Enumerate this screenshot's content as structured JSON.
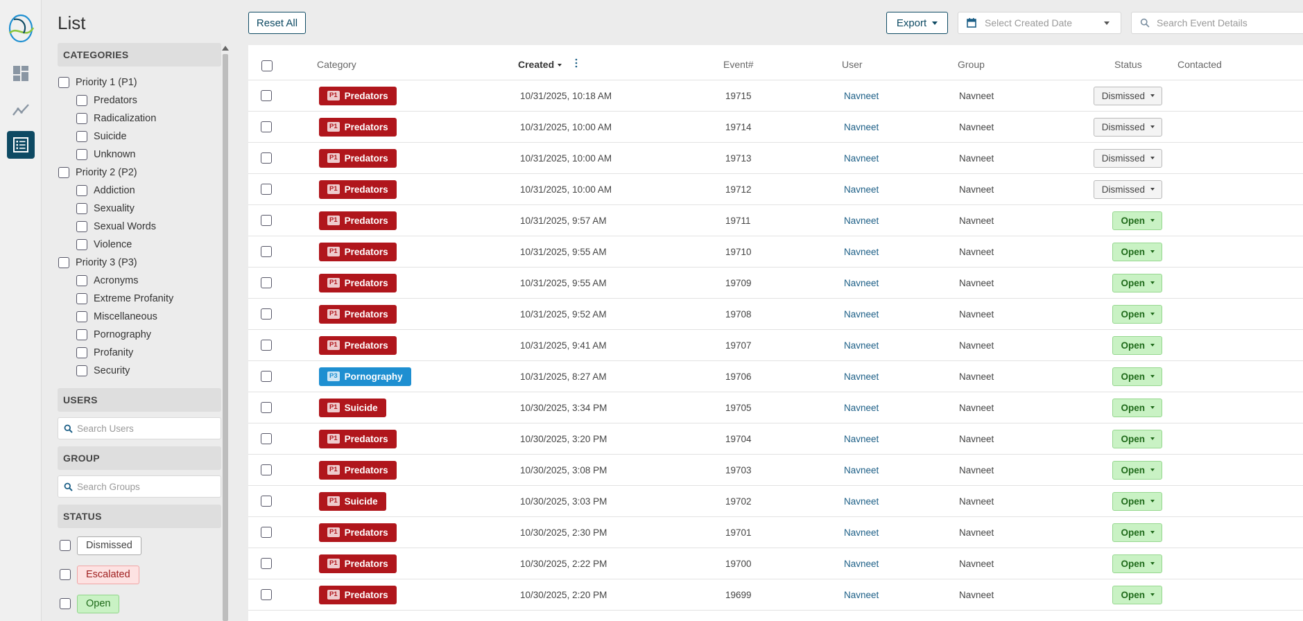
{
  "page": {
    "title": "List"
  },
  "nav": {
    "items": [
      {
        "icon": "dashboard-icon"
      },
      {
        "icon": "analytics-icon"
      },
      {
        "icon": "list-icon",
        "active": true
      }
    ]
  },
  "toolbar": {
    "reset_label": "Reset All",
    "export_label": "Export",
    "date_placeholder": "Select Created Date",
    "search_placeholder": "Search Event Details"
  },
  "filters": {
    "categories_heading": "CATEGORIES",
    "categories": [
      {
        "label": "Priority 1 (P1)",
        "children": [
          "Predators",
          "Radicalization",
          "Suicide",
          "Unknown"
        ]
      },
      {
        "label": "Priority 2 (P2)",
        "children": [
          "Addiction",
          "Sexuality",
          "Sexual Words",
          "Violence"
        ]
      },
      {
        "label": "Priority 3 (P3)",
        "children": [
          "Acronyms",
          "Extreme Profanity",
          "Miscellaneous",
          "Pornography",
          "Profanity",
          "Security"
        ]
      }
    ],
    "users_heading": "USERS",
    "users_placeholder": "Search Users",
    "group_heading": "GROUP",
    "group_placeholder": "Search Groups",
    "status_heading": "STATUS",
    "statuses": [
      "Dismissed",
      "Escalated",
      "Open"
    ]
  },
  "table": {
    "columns": {
      "category": "Category",
      "created": "Created",
      "event": "Event#",
      "user": "User",
      "group": "Group",
      "status": "Status",
      "contacted": "Contacted"
    },
    "rows": [
      {
        "priority": "P1",
        "category": "Predators",
        "created": "10/31/2025, 10:18 AM",
        "event": "19715",
        "user": "Navneet",
        "group": "Navneet",
        "status": "Dismissed"
      },
      {
        "priority": "P1",
        "category": "Predators",
        "created": "10/31/2025, 10:00 AM",
        "event": "19714",
        "user": "Navneet",
        "group": "Navneet",
        "status": "Dismissed"
      },
      {
        "priority": "P1",
        "category": "Predators",
        "created": "10/31/2025, 10:00 AM",
        "event": "19713",
        "user": "Navneet",
        "group": "Navneet",
        "status": "Dismissed"
      },
      {
        "priority": "P1",
        "category": "Predators",
        "created": "10/31/2025, 10:00 AM",
        "event": "19712",
        "user": "Navneet",
        "group": "Navneet",
        "status": "Dismissed"
      },
      {
        "priority": "P1",
        "category": "Predators",
        "created": "10/31/2025, 9:57 AM",
        "event": "19711",
        "user": "Navneet",
        "group": "Navneet",
        "status": "Open"
      },
      {
        "priority": "P1",
        "category": "Predators",
        "created": "10/31/2025, 9:55 AM",
        "event": "19710",
        "user": "Navneet",
        "group": "Navneet",
        "status": "Open"
      },
      {
        "priority": "P1",
        "category": "Predators",
        "created": "10/31/2025, 9:55 AM",
        "event": "19709",
        "user": "Navneet",
        "group": "Navneet",
        "status": "Open"
      },
      {
        "priority": "P1",
        "category": "Predators",
        "created": "10/31/2025, 9:52 AM",
        "event": "19708",
        "user": "Navneet",
        "group": "Navneet",
        "status": "Open"
      },
      {
        "priority": "P1",
        "category": "Predators",
        "created": "10/31/2025, 9:41 AM",
        "event": "19707",
        "user": "Navneet",
        "group": "Navneet",
        "status": "Open"
      },
      {
        "priority": "P3",
        "category": "Pornography",
        "created": "10/31/2025, 8:27 AM",
        "event": "19706",
        "user": "Navneet",
        "group": "Navneet",
        "status": "Open"
      },
      {
        "priority": "P1",
        "category": "Suicide",
        "created": "10/30/2025, 3:34 PM",
        "event": "19705",
        "user": "Navneet",
        "group": "Navneet",
        "status": "Open"
      },
      {
        "priority": "P1",
        "category": "Predators",
        "created": "10/30/2025, 3:20 PM",
        "event": "19704",
        "user": "Navneet",
        "group": "Navneet",
        "status": "Open"
      },
      {
        "priority": "P1",
        "category": "Predators",
        "created": "10/30/2025, 3:08 PM",
        "event": "19703",
        "user": "Navneet",
        "group": "Navneet",
        "status": "Open"
      },
      {
        "priority": "P1",
        "category": "Suicide",
        "created": "10/30/2025, 3:03 PM",
        "event": "19702",
        "user": "Navneet",
        "group": "Navneet",
        "status": "Open"
      },
      {
        "priority": "P1",
        "category": "Predators",
        "created": "10/30/2025, 2:30 PM",
        "event": "19701",
        "user": "Navneet",
        "group": "Navneet",
        "status": "Open"
      },
      {
        "priority": "P1",
        "category": "Predators",
        "created": "10/30/2025, 2:22 PM",
        "event": "19700",
        "user": "Navneet",
        "group": "Navneet",
        "status": "Open"
      },
      {
        "priority": "P1",
        "category": "Predators",
        "created": "10/30/2025, 2:20 PM",
        "event": "19699",
        "user": "Navneet",
        "group": "Navneet",
        "status": "Open"
      }
    ]
  },
  "colors": {
    "brand": "#0e4a63",
    "p1": "#b0161c",
    "p3": "#1e8fd1",
    "open": "#c9f2c4",
    "link": "#1b5e86"
  }
}
